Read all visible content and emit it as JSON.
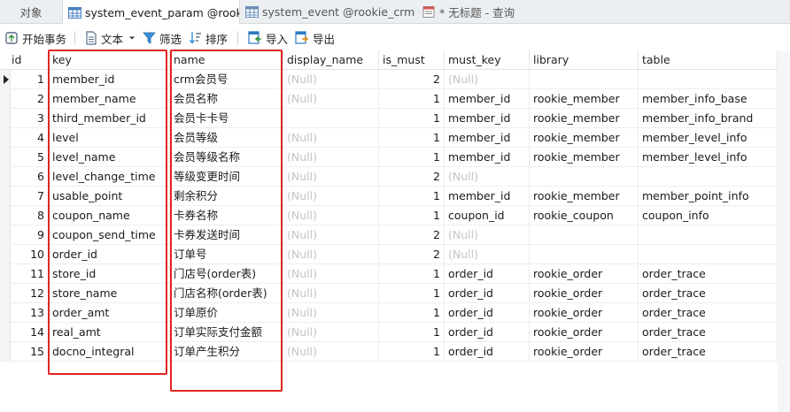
{
  "tabs": [
    {
      "label": "对象",
      "icon": "none"
    },
    {
      "label": "system_event_param @rook...",
      "icon": "table-icon"
    },
    {
      "label": "system_event @rookie_crm ...",
      "icon": "table-icon"
    },
    {
      "label": "* 无标题 - 查询",
      "icon": "query-icon"
    }
  ],
  "toolbar": {
    "begin_transaction": "开始事务",
    "text": "文本",
    "filter": "筛选",
    "sort": "排序",
    "import": "导入",
    "export": "导出"
  },
  "columns": [
    "id",
    "key",
    "name",
    "display_name",
    "is_must",
    "must_key",
    "library",
    "table"
  ],
  "null_text": "(Null)",
  "rows": [
    {
      "id": "1",
      "key": "member_id",
      "name": "crm会员号",
      "display_name": "(Null)",
      "is_must": "2",
      "must_key": "(Null)",
      "library": "",
      "table": ""
    },
    {
      "id": "2",
      "key": "member_name",
      "name": "会员名称",
      "display_name": "(Null)",
      "is_must": "1",
      "must_key": "member_id",
      "library": "rookie_member",
      "table": "member_info_base"
    },
    {
      "id": "3",
      "key": "third_member_id",
      "name": "会员卡卡号",
      "display_name": "",
      "is_must": "1",
      "must_key": "member_id",
      "library": "rookie_member",
      "table": "member_info_brand"
    },
    {
      "id": "4",
      "key": "level",
      "name": "会员等级",
      "display_name": "(Null)",
      "is_must": "1",
      "must_key": "member_id",
      "library": "rookie_member",
      "table": "member_level_info"
    },
    {
      "id": "5",
      "key": "level_name",
      "name": "会员等级名称",
      "display_name": "(Null)",
      "is_must": "1",
      "must_key": "member_id",
      "library": "rookie_member",
      "table": "member_level_info"
    },
    {
      "id": "6",
      "key": "level_change_time",
      "name": "等级变更时间",
      "display_name": "(Null)",
      "is_must": "2",
      "must_key": "(Null)",
      "library": "",
      "table": ""
    },
    {
      "id": "7",
      "key": "usable_point",
      "name": "剩余积分",
      "display_name": "(Null)",
      "is_must": "1",
      "must_key": "member_id",
      "library": "rookie_member",
      "table": "member_point_info"
    },
    {
      "id": "8",
      "key": "coupon_name",
      "name": "卡券名称",
      "display_name": "(Null)",
      "is_must": "1",
      "must_key": "coupon_id",
      "library": "rookie_coupon",
      "table": "coupon_info"
    },
    {
      "id": "9",
      "key": "coupon_send_time",
      "name": "卡券发送时间",
      "display_name": "(Null)",
      "is_must": "2",
      "must_key": "(Null)",
      "library": "",
      "table": ""
    },
    {
      "id": "10",
      "key": "order_id",
      "name": "订单号",
      "display_name": "(Null)",
      "is_must": "2",
      "must_key": "(Null)",
      "library": "",
      "table": ""
    },
    {
      "id": "11",
      "key": "store_id",
      "name": "门店号(order表)",
      "display_name": "(Null)",
      "is_must": "1",
      "must_key": "order_id",
      "library": "rookie_order",
      "table": "order_trace"
    },
    {
      "id": "12",
      "key": "store_name",
      "name": "门店名称(order表)",
      "display_name": "(Null)",
      "is_must": "1",
      "must_key": "order_id",
      "library": "rookie_order",
      "table": "order_trace"
    },
    {
      "id": "13",
      "key": "order_amt",
      "name": "订单原价",
      "display_name": "(Null)",
      "is_must": "1",
      "must_key": "order_id",
      "library": "rookie_order",
      "table": "order_trace"
    },
    {
      "id": "14",
      "key": "real_amt",
      "name": "订单实际支付金额",
      "display_name": "(Null)",
      "is_must": "1",
      "must_key": "order_id",
      "library": "rookie_order",
      "table": "order_trace"
    },
    {
      "id": "15",
      "key": "docno_integral",
      "name": "订单产生积分",
      "display_name": "(Null)",
      "is_must": "1",
      "must_key": "order_id",
      "library": "rookie_order",
      "table": "order_trace"
    }
  ],
  "colors": {
    "highlight": "#e0261f",
    "null_text": "#c4c4c4",
    "accent": "#2b79c2"
  }
}
